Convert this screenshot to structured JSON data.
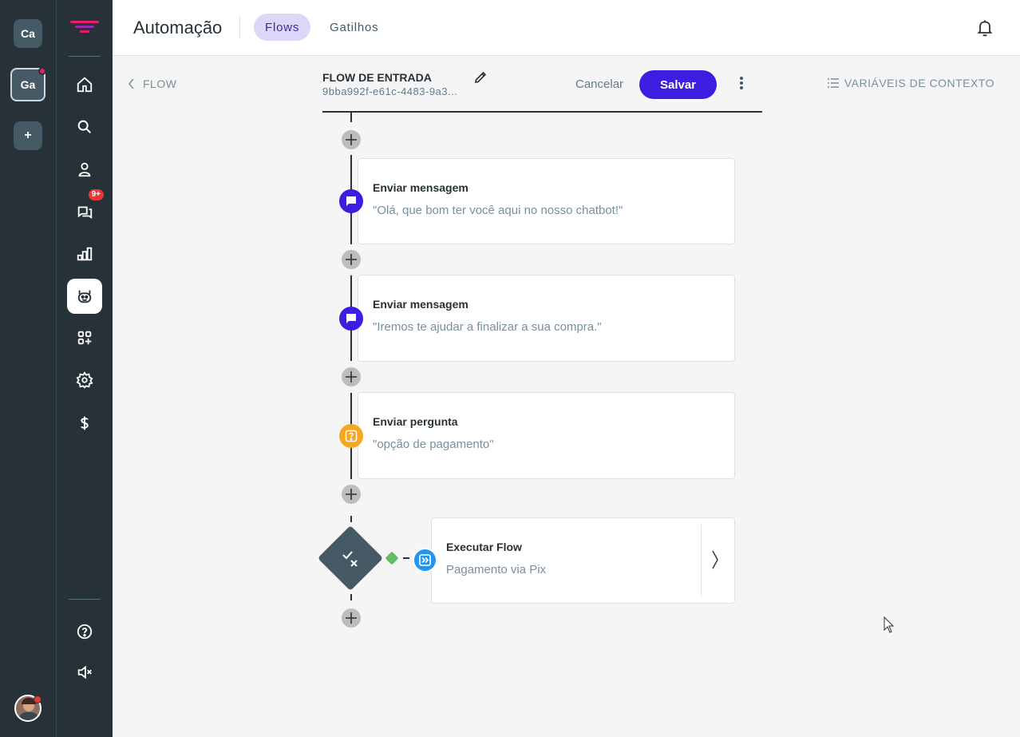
{
  "workspaces": [
    {
      "label": "Ca",
      "active": false
    },
    {
      "label": "Ga",
      "active": true
    },
    {
      "label": "+",
      "active": false
    }
  ],
  "nav": {
    "items": [
      {
        "icon": "home-icon"
      },
      {
        "icon": "search-icon"
      },
      {
        "icon": "contacts-icon"
      },
      {
        "icon": "chat-icon",
        "badge": "9+"
      },
      {
        "icon": "reports-icon"
      },
      {
        "icon": "bot-icon",
        "active": true
      },
      {
        "icon": "apps-add-icon"
      },
      {
        "icon": "settings-icon"
      },
      {
        "icon": "dollar-icon"
      }
    ],
    "bottom": [
      {
        "icon": "help-icon"
      },
      {
        "icon": "mute-icon"
      }
    ]
  },
  "header": {
    "title": "Automação",
    "tabs": [
      {
        "label": "Flows",
        "active": true
      },
      {
        "label": "Gatilhos",
        "active": false
      }
    ]
  },
  "subheader": {
    "back_label": "FLOW",
    "flow_name": "FLOW DE ENTRADA",
    "flow_id": "9bba992f-e61c-4483-9a3...",
    "cancel_label": "Cancelar",
    "save_label": "Salvar",
    "context_label": "VARIÁVEIS DE CONTEXTO"
  },
  "steps": [
    {
      "type": "message",
      "title": "Enviar mensagem",
      "content": "\"Olá, que bom ter você aqui no nosso chatbot!\""
    },
    {
      "type": "message",
      "title": "Enviar mensagem",
      "content": "\"Iremos te ajudar a finalizar a sua compra.\""
    },
    {
      "type": "question",
      "title": "Enviar pergunta",
      "content": "\"opção de pagamento\""
    }
  ],
  "executor": {
    "title": "Executar Flow",
    "subtitle": "Pagamento via Pix"
  },
  "colors": {
    "primary": "#3b1ee0",
    "sidebar": "#263238",
    "question": "#f5a623",
    "executor": "#2196f3",
    "notification": "#e53935"
  }
}
